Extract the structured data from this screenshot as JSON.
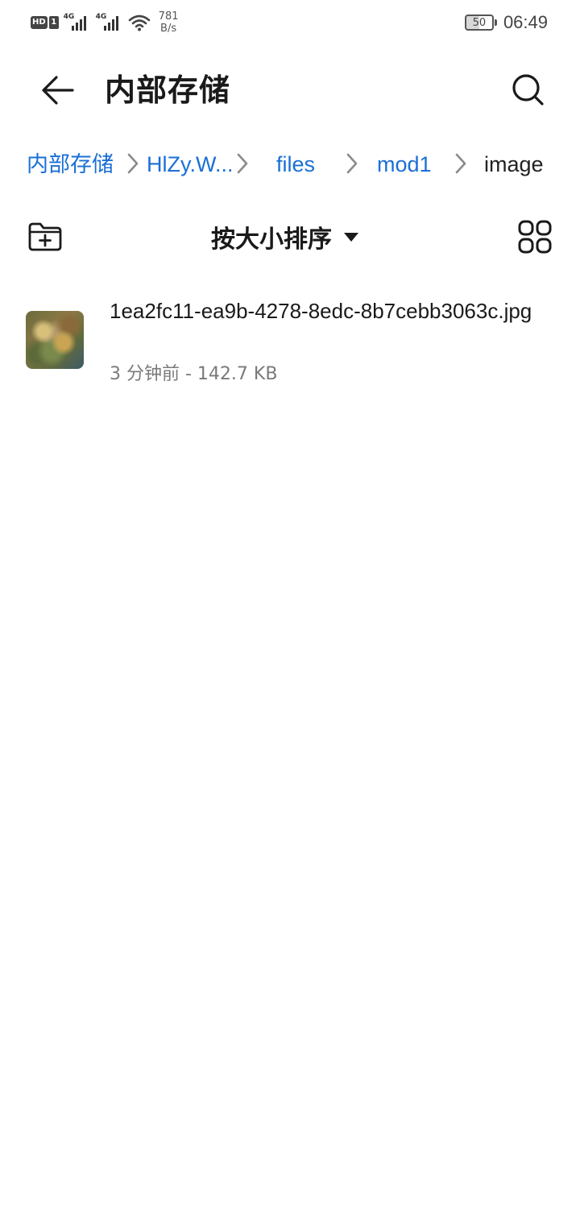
{
  "status_bar": {
    "hd_label": "HD",
    "sim_label": "1",
    "sim1_network": "4G",
    "sim2_network": "4G",
    "net_speed_value": "781",
    "net_speed_unit": "B/s",
    "battery_level": "50",
    "time": "06:49"
  },
  "app_bar": {
    "title": "内部存储"
  },
  "breadcrumb": {
    "items": [
      {
        "label": "内部存储"
      },
      {
        "label": "HlZy.W..."
      },
      {
        "label": "files"
      },
      {
        "label": "mod1"
      },
      {
        "label": "image"
      }
    ]
  },
  "toolbar": {
    "sort_label": "按大小排序"
  },
  "files": [
    {
      "name": "1ea2fc11-ea9b-4278-8edc-8b7cebb3063c.jpg",
      "meta": "3 分钟前 - 142.7 KB"
    }
  ],
  "colors": {
    "accent": "#1a6fd6",
    "text_primary": "#1a1a1a",
    "text_secondary": "#7a7a7a"
  }
}
